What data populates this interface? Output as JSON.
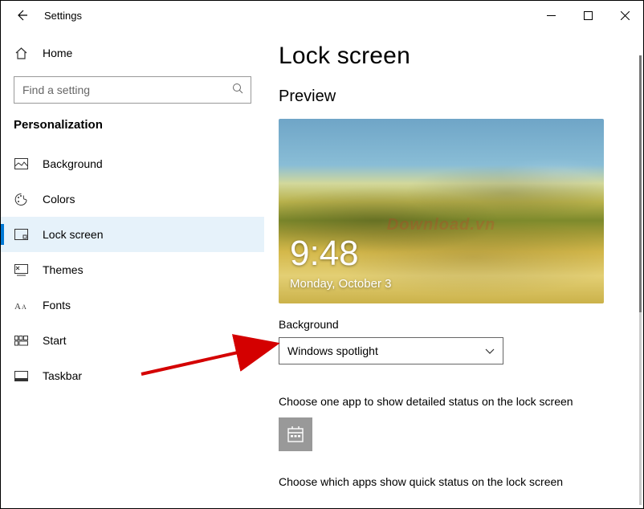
{
  "titlebar": {
    "title": "Settings"
  },
  "sidebar": {
    "home": "Home",
    "search_placeholder": "Find a setting",
    "section": "Personalization",
    "items": [
      {
        "label": "Background"
      },
      {
        "label": "Colors"
      },
      {
        "label": "Lock screen"
      },
      {
        "label": "Themes"
      },
      {
        "label": "Fonts"
      },
      {
        "label": "Start"
      },
      {
        "label": "Taskbar"
      }
    ]
  },
  "content": {
    "heading": "Lock screen",
    "preview_label": "Preview",
    "preview_time": "9:48",
    "preview_date": "Monday, October 3",
    "watermark": "Download.vn",
    "background_label": "Background",
    "background_value": "Windows spotlight",
    "detailed_status_text": "Choose one app to show detailed status on the lock screen",
    "quick_status_text": "Choose which apps show quick status on the lock screen"
  }
}
